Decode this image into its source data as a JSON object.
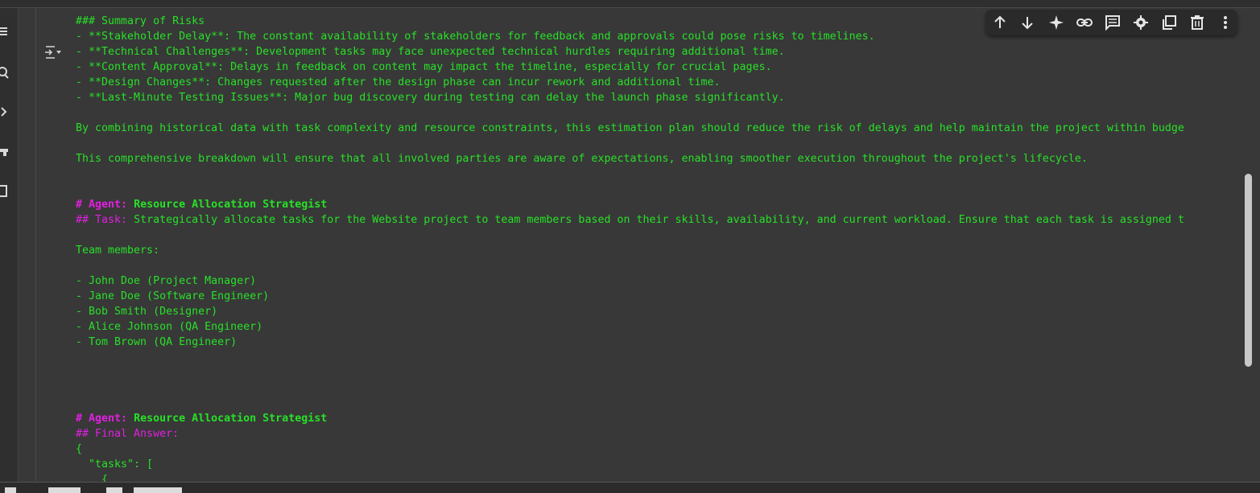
{
  "toolbar": {
    "buttons": [
      {
        "icon": "arrow-up-icon"
      },
      {
        "icon": "arrow-down-icon"
      },
      {
        "icon": "sparkle-icon"
      },
      {
        "icon": "link-icon"
      },
      {
        "icon": "comment-icon"
      },
      {
        "icon": "gear-icon"
      },
      {
        "icon": "mirror-cell-icon"
      },
      {
        "icon": "trash-icon"
      },
      {
        "icon": "more-vert-icon"
      }
    ]
  },
  "output": {
    "risks_heading": "### Summary of Risks",
    "risk_1": "- **Stakeholder Delay**: The constant availability of stakeholders for feedback and approvals could pose risks to timelines.",
    "risk_2": "- **Technical Challenges**: Development tasks may face unexpected technical hurdles requiring additional time.",
    "risk_3": "- **Content Approval**: Delays in feedback on content may impact the timeline, especially for crucial pages.",
    "risk_4": "- **Design Changes**: Changes requested after the design phase can incur rework and additional time.",
    "risk_5": "- **Last-Minute Testing Issues**: Major bug discovery during testing can delay the launch phase significantly.",
    "para_1": "By combining historical data with task complexity and resource constraints, this estimation plan should reduce the risk of delays and help maintain the project within budge",
    "para_2": "This comprehensive breakdown will ensure that all involved parties are aware of expectations, enabling smoother execution throughout the project's lifecycle.",
    "agent_prefix": "# Agent: ",
    "agent_name": "Resource Allocation Strategist",
    "task_prefix": "## Task: ",
    "task_text": "Strategically allocate tasks for the Website project to team members based on their skills, availability, and current workload. Ensure that each task is assigned t",
    "team_heading": "Team members:",
    "member_1": "- John Doe (Project Manager)",
    "member_2": "- Jane Doe (Software Engineer)",
    "member_3": "- Bob Smith (Designer)",
    "member_4": "- Alice Johnson (QA Engineer)",
    "member_5": "- Tom Brown (QA Engineer)",
    "agent2_prefix": "# Agent: ",
    "agent2_name": "Resource Allocation Strategist",
    "final_answer": "## Final Answer:",
    "json_open": "{",
    "json_tasks": "  \"tasks\": [",
    "json_partial": "    {"
  }
}
